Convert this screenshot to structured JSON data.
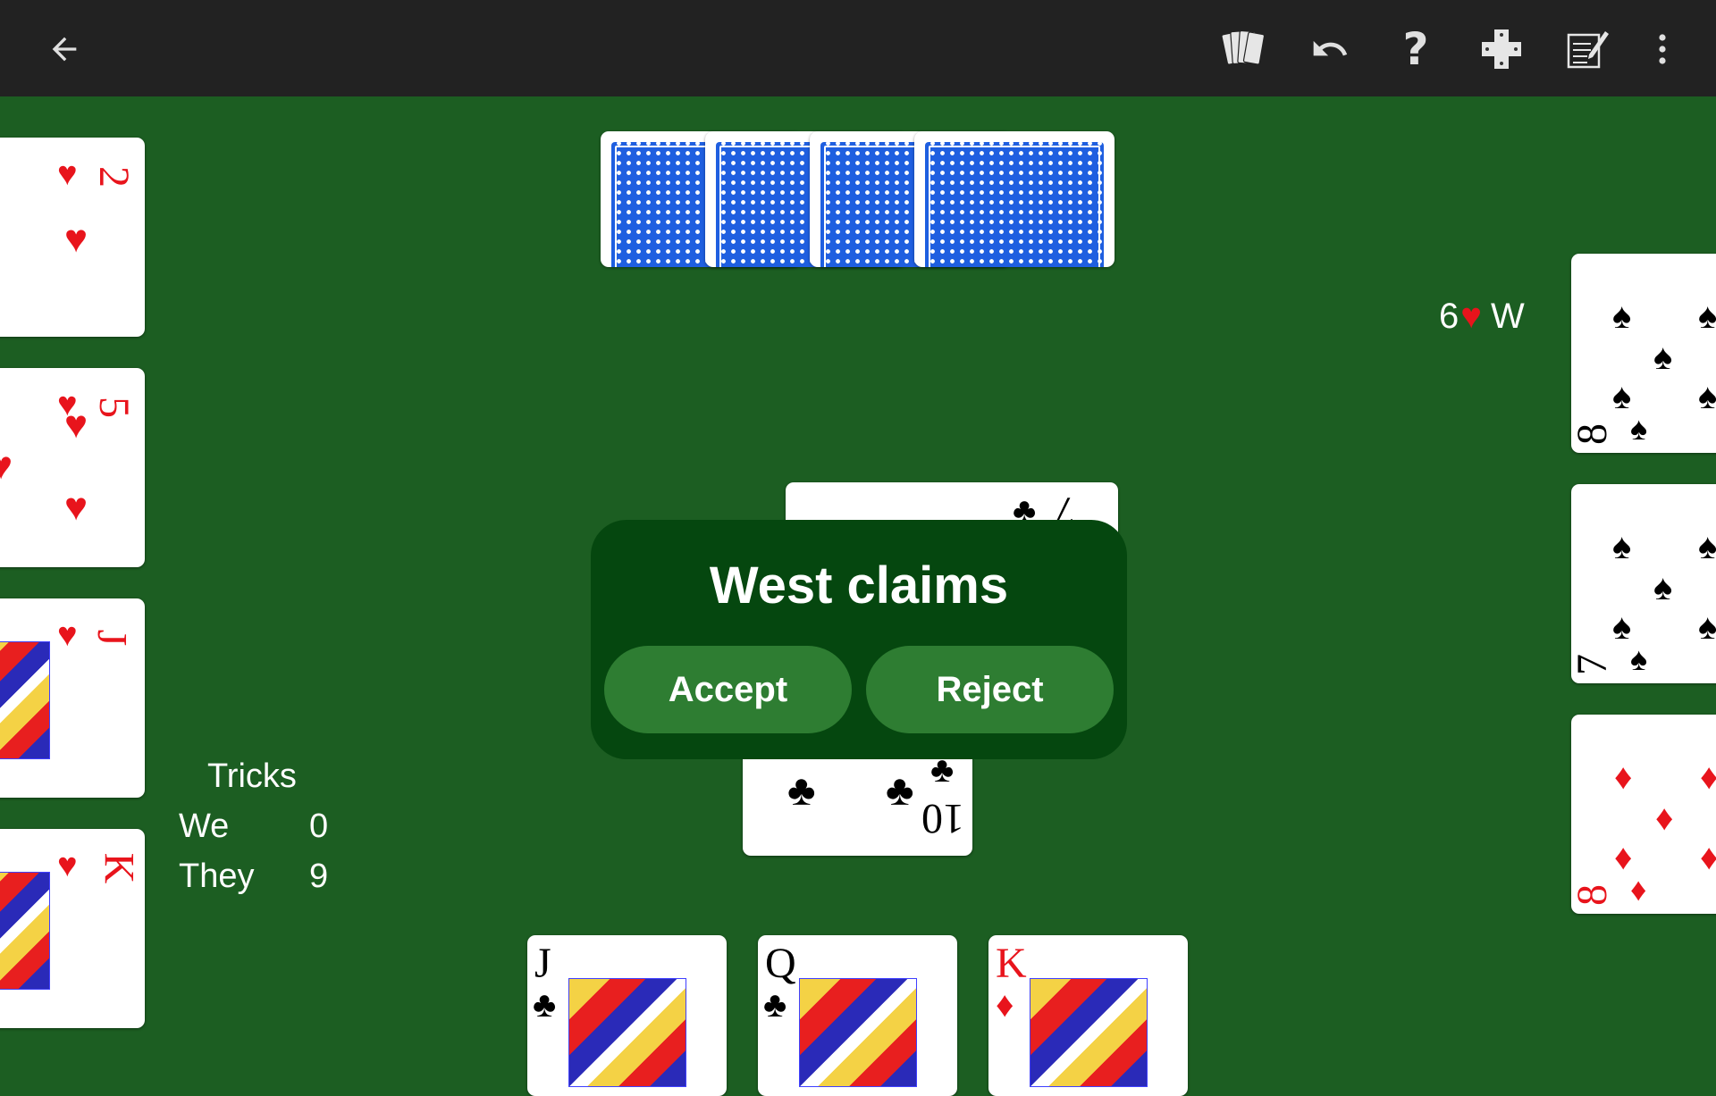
{
  "toolbar": {
    "back": "back-arrow-icon",
    "icons": [
      "cards-hand-icon",
      "undo-icon",
      "help-icon",
      "dpad-icon",
      "notepad-icon",
      "more-vert-icon"
    ]
  },
  "contract": {
    "level": "6",
    "suit": "♥",
    "declarer": "W"
  },
  "west_hand": [
    {
      "rank": "2",
      "suit": "♥"
    },
    {
      "rank": "5",
      "suit": "♥"
    },
    {
      "rank": "J",
      "suit": "♥"
    },
    {
      "rank": "K",
      "suit": "♥"
    }
  ],
  "east_hand": [
    {
      "rank": "8",
      "suit": "♠"
    },
    {
      "rank": "7",
      "suit": "♠"
    },
    {
      "rank": "8",
      "suit": "♦"
    }
  ],
  "south_hand": [
    {
      "rank": "J",
      "suit": "♣"
    },
    {
      "rank": "Q",
      "suit": "♣"
    },
    {
      "rank": "K",
      "suit": "♦"
    }
  ],
  "trick": {
    "north_card": {
      "rank": "7",
      "suit": "♣"
    },
    "south_card": {
      "rank": "10",
      "suit": "♣"
    }
  },
  "tricks": {
    "title": "Tricks",
    "we_label": "We",
    "we_value": "0",
    "they_label": "They",
    "they_value": "9"
  },
  "dialog": {
    "title": "West claims",
    "accept": "Accept",
    "reject": "Reject"
  },
  "colors": {
    "table": "#1c5e22",
    "toolbar": "#222222",
    "dialog": "#05470f",
    "button": "#2e7d32",
    "red_suit": "#e8141c"
  }
}
